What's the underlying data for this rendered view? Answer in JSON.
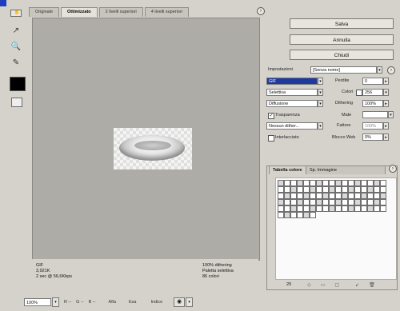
{
  "tabs": [
    "Originale",
    "Ottimizzato",
    "2 livelli superiori",
    "4 livelli superiori"
  ],
  "active_tab": 1,
  "buttons": {
    "save": "Salva",
    "cancel": "Annulla",
    "done": "Chiudi"
  },
  "settings": {
    "label": "Impostazioni",
    "preset": "[Senza nome]",
    "format": "GIF",
    "palette": "Selettiva",
    "dither": "Diffusione",
    "transparency": "Trasparenza",
    "transparency_checked": true,
    "matte_dither": "Nessun dither...",
    "interlaced": "Interlacciato",
    "interlaced_checked": false,
    "loss_label": "Perdite",
    "loss_value": "0",
    "colors_label": "Colori",
    "colors_value": "256",
    "dithering_label": "Dithering",
    "dithering_value": "100%",
    "matte_label": "Mate",
    "amount_label": "Fattore",
    "amount_value": "100%",
    "web_snap_label": "Blocco Web",
    "web_snap_value": "0%"
  },
  "palette": {
    "tab1": "Tabella colore",
    "tab2": "Sp. Immagine",
    "count": "20",
    "rows_full": 6,
    "cols": 17
  },
  "status": {
    "format": "GIF",
    "size": "3,921K",
    "time": "2 sec @ 56,6Kbps",
    "dither": "100% dithering",
    "palette": "Paletta selettiva",
    "colors": "86 colori"
  },
  "bottom": {
    "zoom": "100%",
    "r": "R --",
    "g": "G --",
    "b": "B --",
    "alpha": "Alfa",
    "hex": "Esa",
    "index": "Indice"
  }
}
